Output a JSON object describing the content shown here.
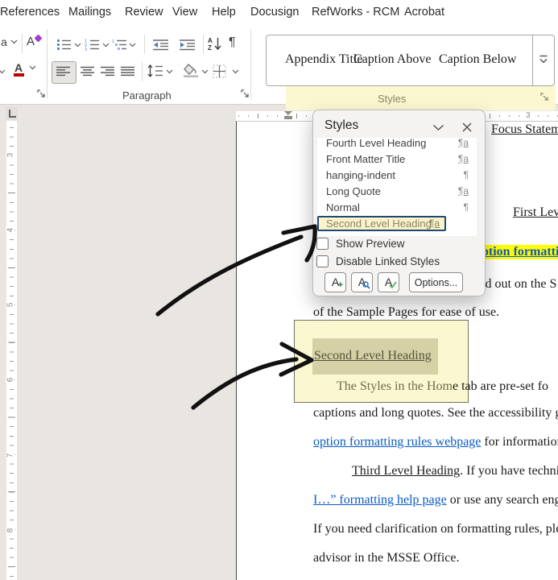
{
  "menu": {
    "items": [
      "References",
      "Mailings",
      "Review",
      "View",
      "Help",
      "Docusign",
      "RefWorks - RCM",
      "Acrobat"
    ]
  },
  "ribbon": {
    "paragraph_group_label": "Paragraph",
    "styles_group_label": "Styles",
    "gallery": {
      "items": [
        "Appendix Title",
        "Caption Above",
        "Caption Below"
      ]
    },
    "icons": {
      "change_case": "a",
      "clear_formatting": "A",
      "font_color": "A",
      "sort_a": "A",
      "sort_z": "Z",
      "pilcrow": "¶"
    }
  },
  "styles_panel": {
    "title": "Styles",
    "items": [
      {
        "label": "Fourth Level Heading",
        "glyph": "¶a",
        "linked": true,
        "selected": false
      },
      {
        "label": "Front Matter Title",
        "glyph": "¶a",
        "linked": true,
        "selected": false
      },
      {
        "label": "hanging-indent",
        "glyph": "¶",
        "linked": false,
        "selected": false
      },
      {
        "label": "Long Quote",
        "glyph": "¶a",
        "linked": true,
        "selected": false
      },
      {
        "label": "Normal",
        "glyph": "¶",
        "linked": false,
        "selected": false
      },
      {
        "label": "Second Level Heading",
        "glyph": "¶a",
        "linked": true,
        "selected": true
      }
    ],
    "checkboxes": [
      {
        "label": "Show Preview",
        "checked": false
      },
      {
        "label": "Disable Linked Styles",
        "checked": false
      }
    ],
    "buttons": {
      "new_style": "A",
      "style_inspector": "A",
      "manage_styles": "A",
      "options": "Options..."
    }
  },
  "ruler": {
    "horizontal_label": "3",
    "vertical_labels": [
      "3",
      "4",
      "5",
      "6",
      "7",
      "8"
    ]
  },
  "document": {
    "heading_focus": "Focus Statement",
    "heading_first": "First Level Heading",
    "frag_highlight_link": "ption formatting",
    "frag_laid": "id out on the S",
    "line_sample": "of the Sample Pages for ease of use.",
    "note_heading": "Second Level Heading",
    "note_line_inside": "The Styles in the Hom",
    "note_line_outside": "e tab are pre-set fo",
    "line_captions": "captions and long quotes. See the accessibility gui",
    "link_option": "option formatting rules webpage",
    "line_option_rest": " for information o",
    "heading_third": "Third Level Heading",
    "line_third_rest": ". If you have technical",
    "link_help": "I…” formatting help page",
    "line_help_rest": " or use any search engine",
    "line_clarification": "If you need clarification on formatting rules, please",
    "line_advisor": "advisor in the MSSE Office."
  },
  "colors": {
    "link_blue": "#0b5cc4",
    "text_highlight": "#ffff00",
    "ribbon_group_highlight": "#fbf8d1",
    "note_box_bg": "#fbf7d0",
    "selection_khaki": "#d6d0a6",
    "selected_style_border": "#1d4a72",
    "selected_style_bg": "#fcf3cb",
    "annotation_arrow": "#111111"
  }
}
